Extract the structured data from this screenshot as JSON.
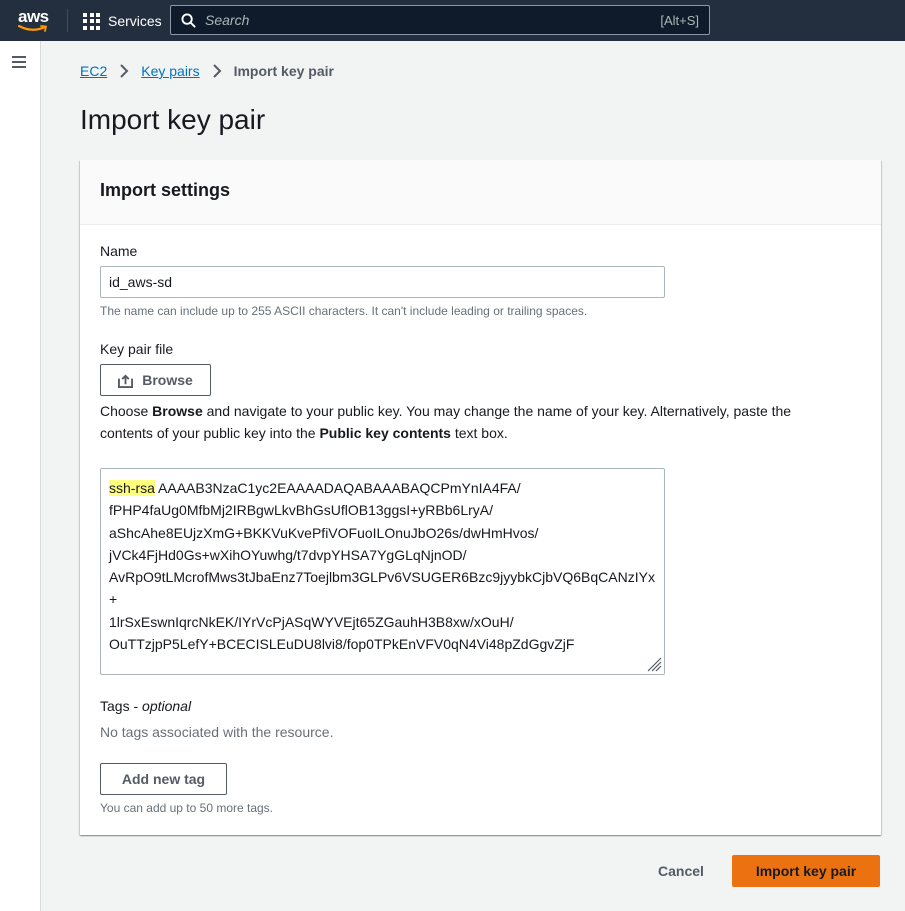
{
  "topnav": {
    "logo_text": "aws",
    "services_label": "Services",
    "search_placeholder": "Search",
    "search_shortcut": "[Alt+S]"
  },
  "breadcrumb": {
    "items": [
      "EC2",
      "Key pairs"
    ],
    "current": "Import key pair"
  },
  "page_title": "Import key pair",
  "panel": {
    "title": "Import settings",
    "name_label": "Name",
    "name_value": "id_aws-sd",
    "name_hint": "The name can include up to 255 ASCII characters. It can't include leading or trailing spaces.",
    "keyfile_label": "Key pair file",
    "browse_label": "Browse",
    "description": {
      "part1": "Choose ",
      "bold1": "Browse",
      "part2": " and navigate to your public key. You may change the name of your key. Alternatively, paste the contents of your public key into the ",
      "bold2": "Public key contents",
      "part3": " text box."
    },
    "key_prefix": "ssh-rsa",
    "key_body": " AAAAB3NzaC1yc2EAAAADAQABAAABAQCPmYnIA4FA/fPHP4faUg0MfbMj2IRBgwLkvBhGsUflOB13ggsI+yRBb6LryA/aShcAhe8EUjzXmG+BKKVuKvePfiVOFuoILOnuJbO26s/dwHmHvos/jVCk4FjHd0Gs+wXihOYuwhg/t7dvpYHSA7YgGLqNjnOD/AvRpO9tLMcrofMws3tJbaEnz7Toejlbm3GLPv6VSUGER6Bzc9jyybkCjbVQ6BqCANzIYx+1lrSxEswnIqrcNkEK/IYrVcPjASqWYVEjt65ZGauhH3B8xw/xOuH/OuTTzjpP5LefY+BCECISLEuDU8lvi8/fop0TPkEnVFV0qN4Vi48pZdGgvZjF",
    "key_lines": [
      "AAAAB3NzaC1yc2EAAAADAQABAAABAQCPmYnIA4FA/",
      "fPHP4faUg0MfbMj2IRBgwLkvBhGsUflOB13ggsI+yRBb6LryA/",
      "aShcAhe8EUjzXmG+BKKVuKvePfiVOFuoILOnuJbO26s/dwHmHvos/",
      "jVCk4FjHd0Gs+wXihOYuwhg/t7dvpYHSA7YgGLqNjnOD/",
      "AvRpO9tLMcrofMws3tJbaEnz7Toejlbm3GLPv6VSUGER6Bzc9jyybkCjbVQ6BqCANzIYx+",
      "1lrSxEswnIqrcNkEK/IYrVcPjASqWYVEjt65ZGauhH3B8xw/xOuH/",
      "OuTTzjpP5LefY+BCECISLEuDU8lvi8/fop0TPkEnVFV0qN4Vi48pZdGgvZjF"
    ],
    "tags_label": "Tags",
    "tags_optional": "optional",
    "tags_empty": "No tags associated with the resource.",
    "add_tag_label": "Add new tag",
    "tags_hint": "You can add up to 50 more tags."
  },
  "footer": {
    "cancel_label": "Cancel",
    "submit_label": "Import key pair"
  },
  "colors": {
    "nav_bg": "#232f3e",
    "link": "#0073bb",
    "primary": "#ec7211",
    "highlight": "#ffff7f"
  }
}
